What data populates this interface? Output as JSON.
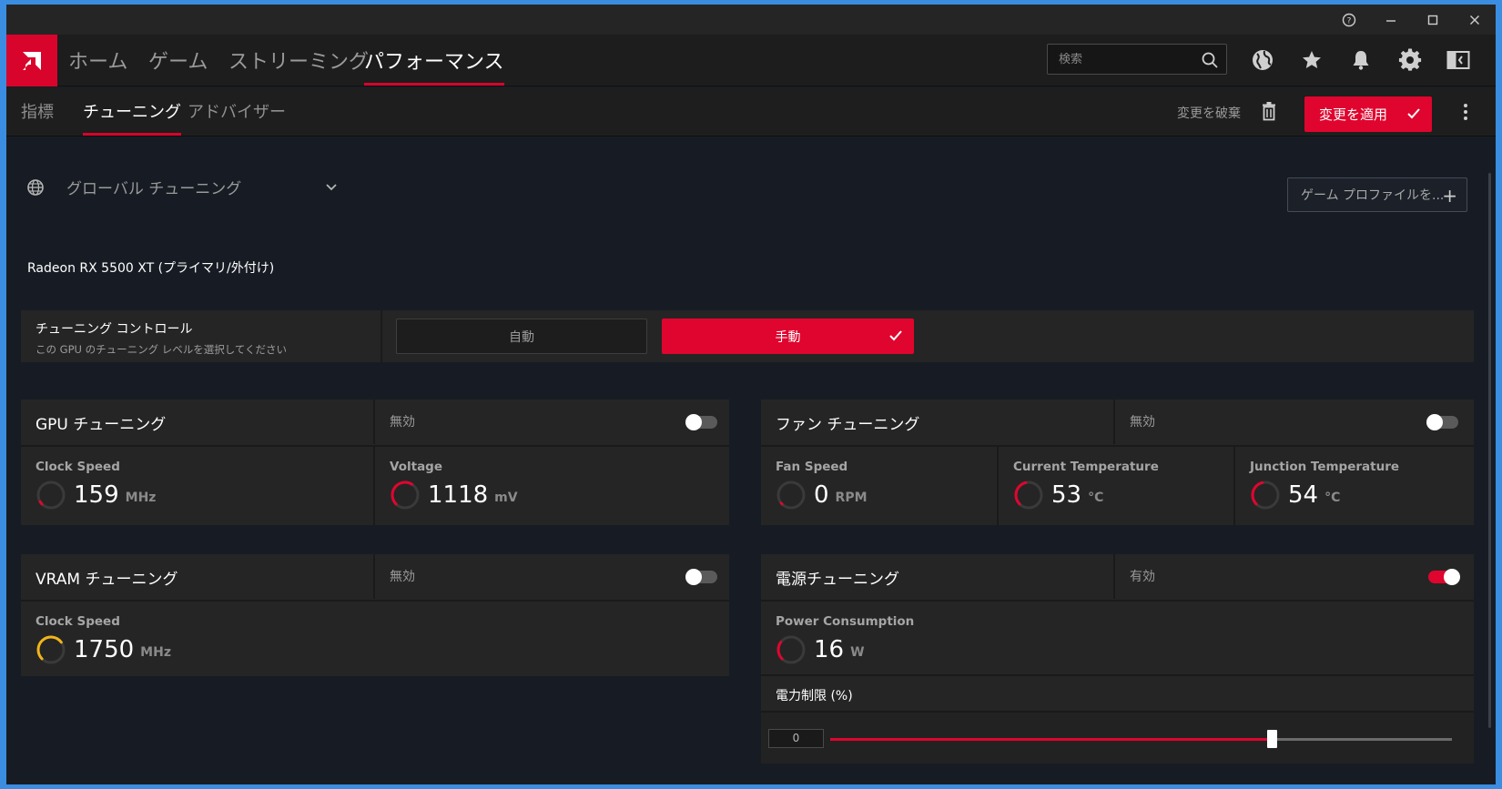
{
  "window": {
    "controls": {
      "help": "?",
      "minimize": "—",
      "maximize": "☐",
      "close": "✕"
    }
  },
  "nav": {
    "items": [
      {
        "label": "ホーム",
        "active": false
      },
      {
        "label": "ゲーム",
        "active": false
      },
      {
        "label": "ストリーミング",
        "active": false
      },
      {
        "label": "パフォーマンス",
        "active": true
      }
    ],
    "search_placeholder": "検索",
    "icons": [
      "globe-icon",
      "star-icon",
      "bell-icon",
      "gear-icon",
      "sidebar-icon"
    ]
  },
  "subnav": {
    "tabs": [
      {
        "label": "指標",
        "active": false
      },
      {
        "label": "チューニング",
        "active": true
      },
      {
        "label": "アドバイザー",
        "active": false
      }
    ],
    "discard_label": "変更を破棄",
    "apply_label": "変更を適用"
  },
  "content": {
    "profile_selector": "グローバル チューニング",
    "add_profile_label": "ゲーム プロファイルを...",
    "device_name": "Radeon RX 5500 XT (プライマリ/外付け)",
    "tuning_control": {
      "title": "チューニング コントロール",
      "subtitle": "この GPU のチューニング レベルを選択してください",
      "auto_label": "自動",
      "manual_label": "手動",
      "selected": "manual"
    },
    "gpu_tuning": {
      "title": "GPU チューニング",
      "state": "無効",
      "enabled": false,
      "metrics": [
        {
          "label": "Clock Speed",
          "value": "159",
          "unit": "MHz",
          "level": 0.05,
          "color": "#e0052e"
        },
        {
          "label": "Voltage",
          "value": "1118",
          "unit": "mV",
          "level": 0.62,
          "color": "#e0052e"
        }
      ]
    },
    "fan_tuning": {
      "title": "ファン チューニング",
      "state": "無効",
      "enabled": false,
      "metrics": [
        {
          "label": "Fan Speed",
          "value": "0",
          "unit": "RPM",
          "level": 0,
          "color": "#e0052e"
        },
        {
          "label": "Current Temperature",
          "value": "53",
          "unit": "°C",
          "level": 0.45,
          "color": "#e0052e"
        },
        {
          "label": "Junction Temperature",
          "value": "54",
          "unit": "°C",
          "level": 0.45,
          "color": "#e0052e"
        }
      ]
    },
    "vram_tuning": {
      "title": "VRAM チューニング",
      "state": "無効",
      "enabled": false,
      "metrics": [
        {
          "label": "Clock Speed",
          "value": "1750",
          "unit": "MHz",
          "level": 0.7,
          "color": "#f1b51a"
        }
      ]
    },
    "power_tuning": {
      "title": "電源チューニング",
      "state": "有効",
      "enabled": true,
      "metrics": [
        {
          "label": "Power Consumption",
          "value": "16",
          "unit": "W",
          "level": 0.3,
          "color": "#e0052e"
        }
      ],
      "limit_label": "電力制限 (%)",
      "limit_value": "0",
      "limit_position": 0.71
    }
  }
}
